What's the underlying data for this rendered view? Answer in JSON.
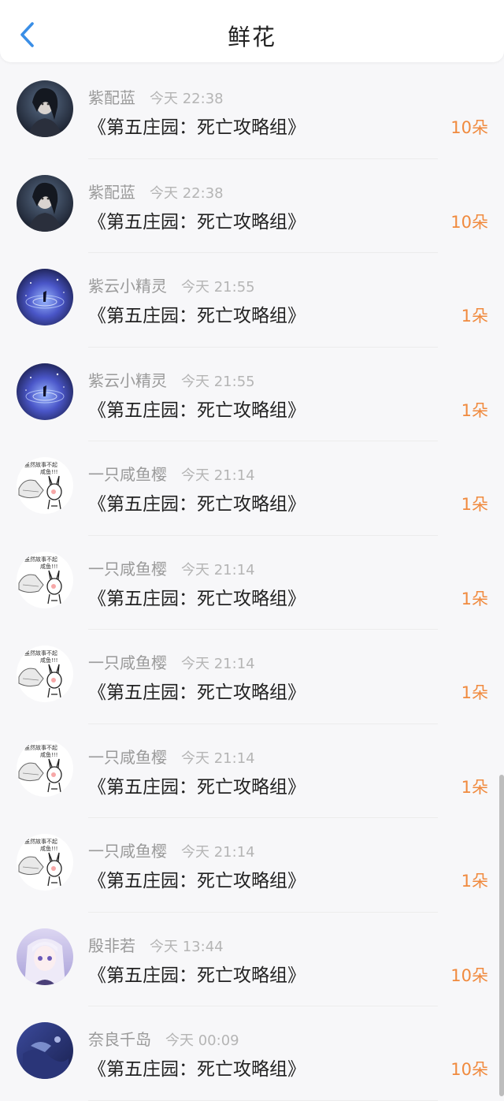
{
  "header": {
    "title": "鲜花",
    "back_icon": "chevron-left-icon",
    "accent": "#3a8ee6"
  },
  "colors": {
    "count": "#f08a3e"
  },
  "rows": [
    {
      "name": "紫配蓝",
      "time": "今天 22:38",
      "book": "《第五庄园：死亡攻略组》",
      "count": "10朵",
      "avatar": "dark"
    },
    {
      "name": "紫配蓝",
      "time": "今天 22:38",
      "book": "《第五庄园：死亡攻略组》",
      "count": "10朵",
      "avatar": "dark"
    },
    {
      "name": "紫云小精灵",
      "time": "今天 21:55",
      "book": "《第五庄园：死亡攻略组》",
      "count": "1朵",
      "avatar": "galaxy"
    },
    {
      "name": "紫云小精灵",
      "time": "今天 21:55",
      "book": "《第五庄园：死亡攻略组》",
      "count": "1朵",
      "avatar": "galaxy"
    },
    {
      "name": "一只咸鱼樱",
      "time": "今天 21:14",
      "book": "《第五庄园：死亡攻略组》",
      "count": "1朵",
      "avatar": "meme",
      "avatar_text": [
        "虽然故事不起",
        "咸鱼!!!"
      ]
    },
    {
      "name": "一只咸鱼樱",
      "time": "今天 21:14",
      "book": "《第五庄园：死亡攻略组》",
      "count": "1朵",
      "avatar": "meme",
      "avatar_text": [
        "虽然故事不起",
        "咸鱼!!!"
      ]
    },
    {
      "name": "一只咸鱼樱",
      "time": "今天 21:14",
      "book": "《第五庄园：死亡攻略组》",
      "count": "1朵",
      "avatar": "meme",
      "avatar_text": [
        "虽然故事不起",
        "咸鱼!!!"
      ]
    },
    {
      "name": "一只咸鱼樱",
      "time": "今天 21:14",
      "book": "《第五庄园：死亡攻略组》",
      "count": "1朵",
      "avatar": "meme",
      "avatar_text": [
        "虽然故事不起",
        "咸鱼!!!"
      ]
    },
    {
      "name": "一只咸鱼樱",
      "time": "今天 21:14",
      "book": "《第五庄园：死亡攻略组》",
      "count": "1朵",
      "avatar": "meme",
      "avatar_text": [
        "虽然故事不起",
        "咸鱼!!!"
      ]
    },
    {
      "name": "殷非若",
      "time": "今天 13:44",
      "book": "《第五庄园：死亡攻略组》",
      "count": "10朵",
      "avatar": "anime"
    },
    {
      "name": "奈良千岛",
      "time": "今天 00:09",
      "book": "《第五庄园：死亡攻略组》",
      "count": "10朵",
      "avatar": "blue"
    }
  ]
}
